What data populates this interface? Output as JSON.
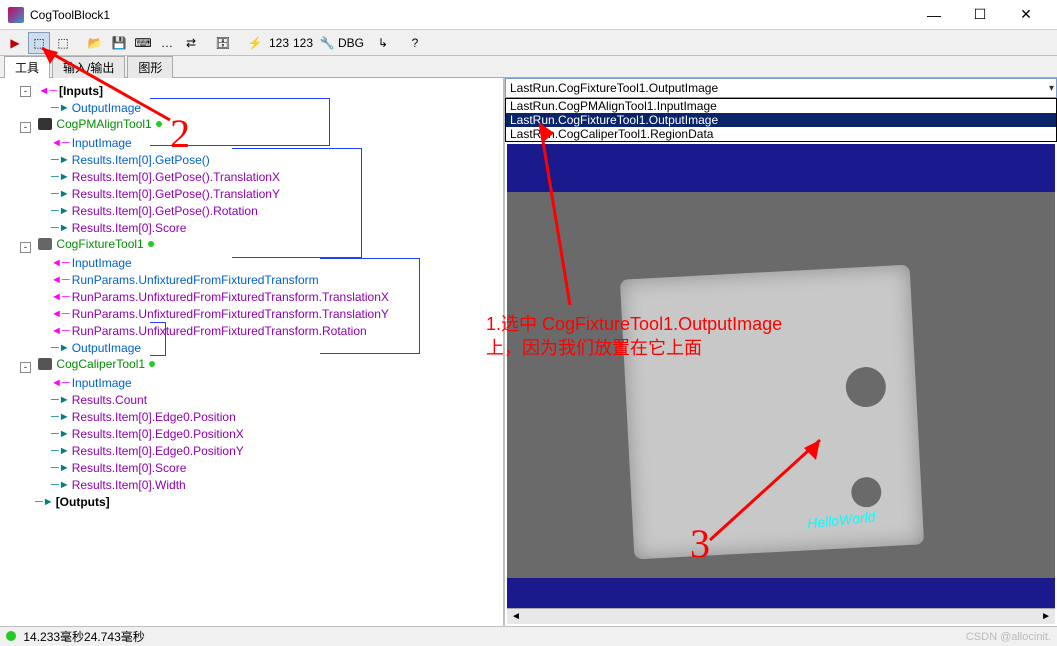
{
  "window": {
    "title": "CogToolBlock1",
    "min": "—",
    "max": "☐",
    "close": "✕"
  },
  "toolbar": {
    "run": "▶",
    "b1": "⬚",
    "b2": "⬚",
    "b3": "📂",
    "b4": "💾",
    "b5": "⌨",
    "b6": "…",
    "b7": "⇄",
    "b8": "🗄",
    "b9": "⚡",
    "b10": "123",
    "b11": "123",
    "b12": "🔧",
    "b13": "DBG",
    "b14": "↳",
    "b15": "?"
  },
  "tabs": {
    "t1": "工具",
    "t2": "输入/输出",
    "t3": "图形"
  },
  "tree": {
    "inputs": "[Inputs]",
    "outputImage": "OutputImage",
    "pmalign": "CogPMAlignTool1",
    "inputImage": "InputImage",
    "getPose": "Results.Item[0].GetPose()",
    "getPoseTX": "Results.Item[0].GetPose().TranslationX",
    "getPoseTY": "Results.Item[0].GetPose().TranslationY",
    "getPoseRot": "Results.Item[0].GetPose().Rotation",
    "score": "Results.Item[0].Score",
    "fixture": "CogFixtureTool1",
    "runParams": "RunParams.UnfixturedFromFixturedTransform",
    "runParamsTX": "RunParams.UnfixturedFromFixturedTransform.TranslationX",
    "runParamsTY": "RunParams.UnfixturedFromFixturedTransform.TranslationY",
    "runParamsRot": "RunParams.UnfixturedFromFixturedTransform.Rotation",
    "caliper": "CogCaliperTool1",
    "resCount": "Results.Count",
    "e0pos": "Results.Item[0].Edge0.Position",
    "e0posX": "Results.Item[0].Edge0.PositionX",
    "e0posY": "Results.Item[0].Edge0.PositionY",
    "resScore": "Results.Item[0].Score",
    "resWidth": "Results.Item[0].Width",
    "outputs": "[Outputs]"
  },
  "combo": {
    "selected": "LastRun.CogFixtureTool1.OutputImage",
    "opt1": "LastRun.CogPMAlignTool1.InputImage",
    "opt2": "LastRun.CogFixtureTool1.OutputImage",
    "opt3": "LastRun.CogCaliperTool1.RegionData"
  },
  "viewer": {
    "overlay": "HelloWorld",
    "scrollL": "◄",
    "scrollR": "►"
  },
  "status": {
    "time": "14.233毫秒24.743毫秒",
    "watermark": "CSDN @allocinit."
  },
  "annot": {
    "n2": "2",
    "n3": "3",
    "l1": "1.选中 CogFixtureTool1.OutputImage",
    "l2": "上，因为我们放置在它上面"
  }
}
